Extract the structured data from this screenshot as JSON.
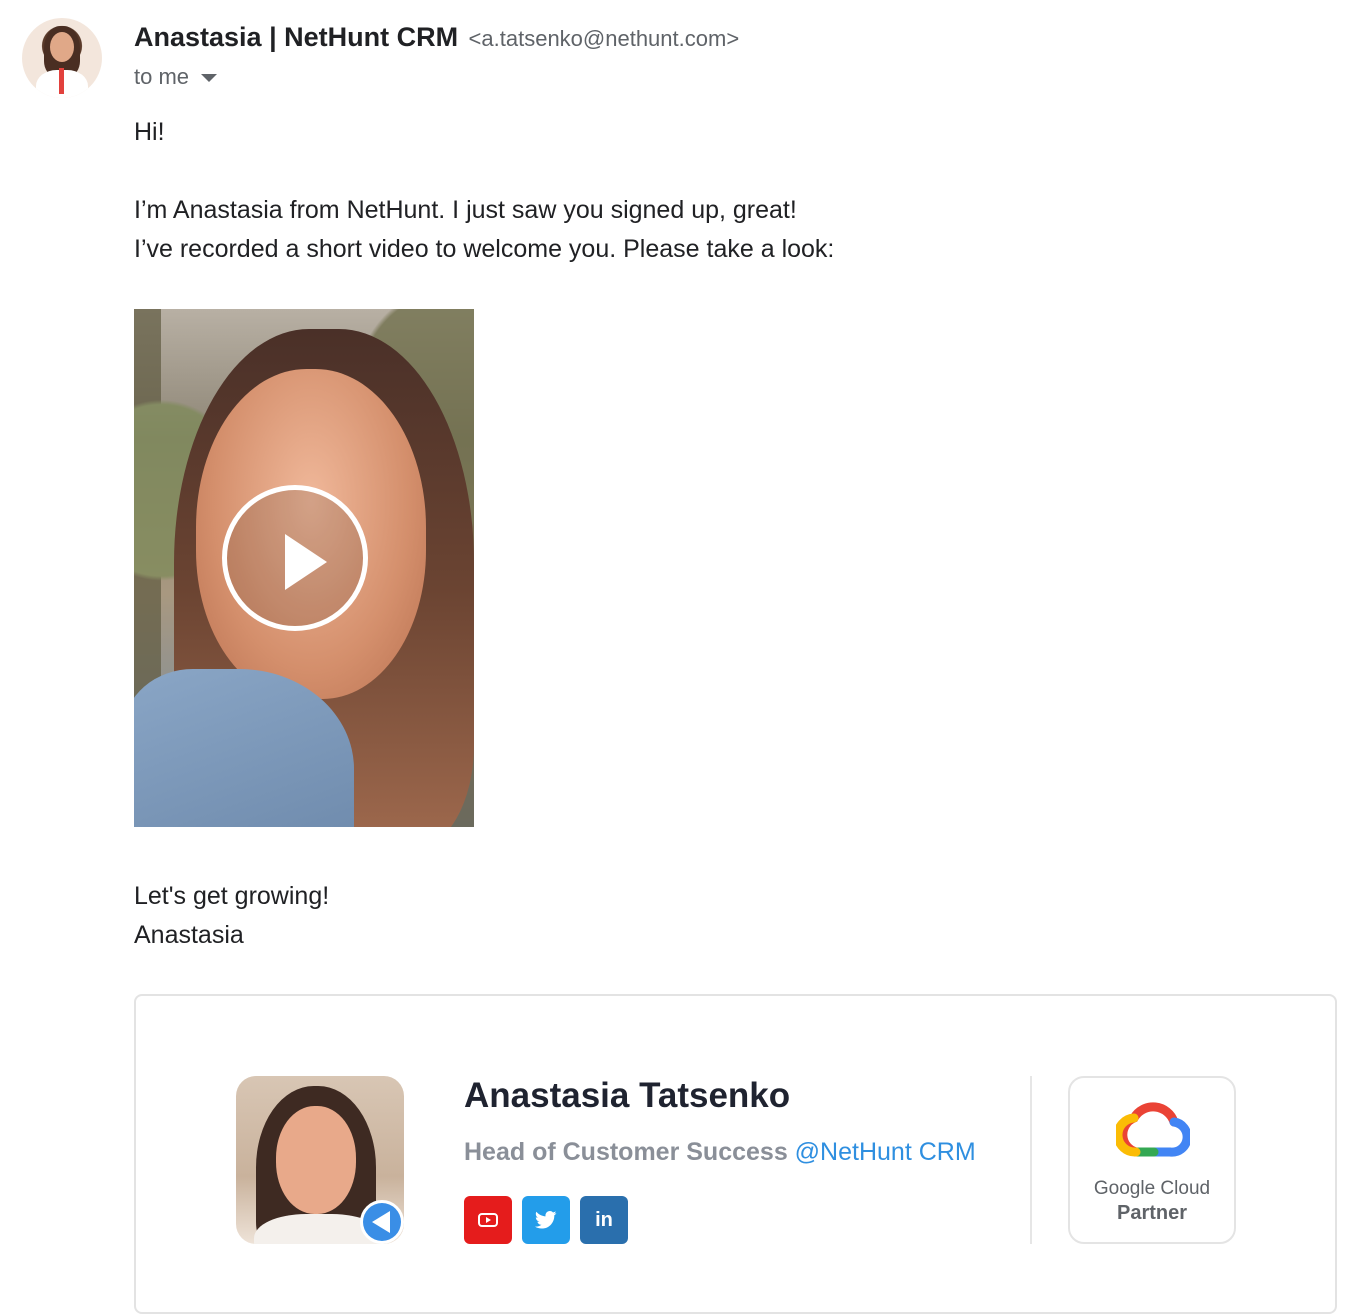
{
  "header": {
    "sender_name": "Anastasia | NetHunt CRM",
    "sender_email": "<a.tatsenko@nethunt.com>",
    "recipient": "to me"
  },
  "message": {
    "greeting": "Hi!",
    "line1": "I’m Anastasia from NetHunt. I just saw you signed up, great!",
    "line2": "I’ve recorded a short video to welcome you. Please take a look:",
    "closing": "Let's get growing!",
    "sign_off": "Anastasia"
  },
  "signature": {
    "name": "Anastasia Tatsenko",
    "role": "Head of Customer Success",
    "company": "@NetHunt CRM",
    "socials": [
      {
        "icon": "youtube-icon",
        "color": "#e51c1c"
      },
      {
        "icon": "twitter-icon",
        "color": "#239dea"
      },
      {
        "icon": "linkedin-icon",
        "label": "in",
        "color": "#2a6fad"
      }
    ],
    "partner": {
      "line1": "Google Cloud",
      "line2": "Partner"
    }
  },
  "colors": {
    "link": "#2f8fe0",
    "text": "#202124",
    "muted": "#5f6368"
  }
}
